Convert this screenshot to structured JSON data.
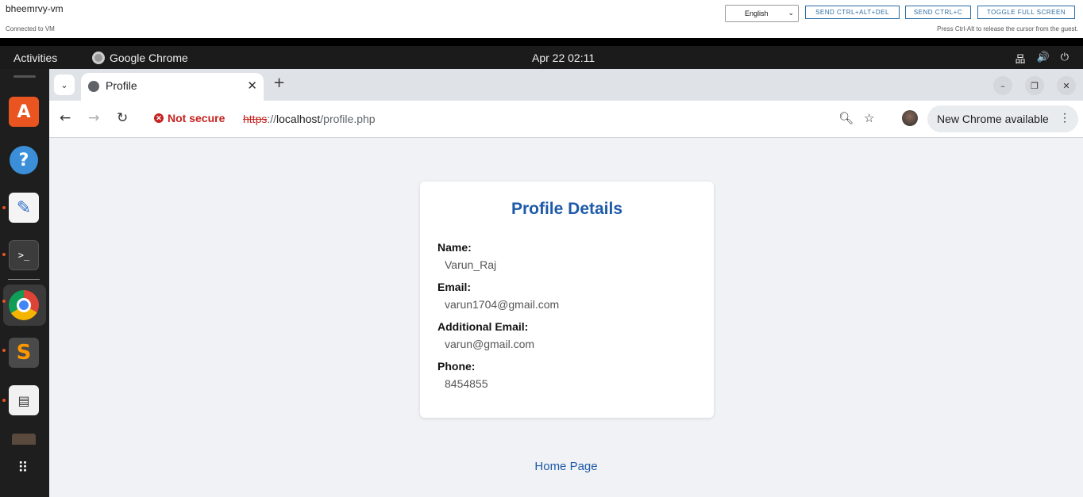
{
  "vm": {
    "name": "bheemrvy-vm",
    "status": "Connected to VM",
    "language": "English",
    "buttons": [
      "SEND CTRL+ALT+DEL",
      "SEND CTRL+C",
      "TOGGLE FULL SCREEN"
    ],
    "hint": "Press Ctrl-Alt to release the cursor from the guest."
  },
  "gnome": {
    "activities": "Activities",
    "app_name": "Google Chrome",
    "clock": "Apr 22  02:11"
  },
  "dock": {
    "icons": [
      "app-center-icon",
      "help-icon",
      "text-editor-icon",
      "terminal-icon",
      "chrome-icon",
      "sublime-text-icon",
      "document-viewer-icon",
      "app-grid-icon"
    ]
  },
  "browser": {
    "tab_title": "Profile",
    "not_secure": "Not secure",
    "url_scheme": "https",
    "url_sep": "://",
    "url_host": "localhost",
    "url_path": "/profile.php",
    "update_label": "New Chrome available"
  },
  "profile": {
    "heading": "Profile Details",
    "fields": [
      {
        "label": "Name:",
        "value": "Varun_Raj"
      },
      {
        "label": "Email:",
        "value": "varun1704@gmail.com"
      },
      {
        "label": "Additional Email:",
        "value": "varun@gmail.com"
      },
      {
        "label": "Phone:",
        "value": "8454855"
      }
    ],
    "home_link": "Home Page"
  },
  "colors": {
    "heading": "#1e5aa8",
    "not_secure": "#c5221f",
    "ubuntu_orange": "#e95420"
  }
}
